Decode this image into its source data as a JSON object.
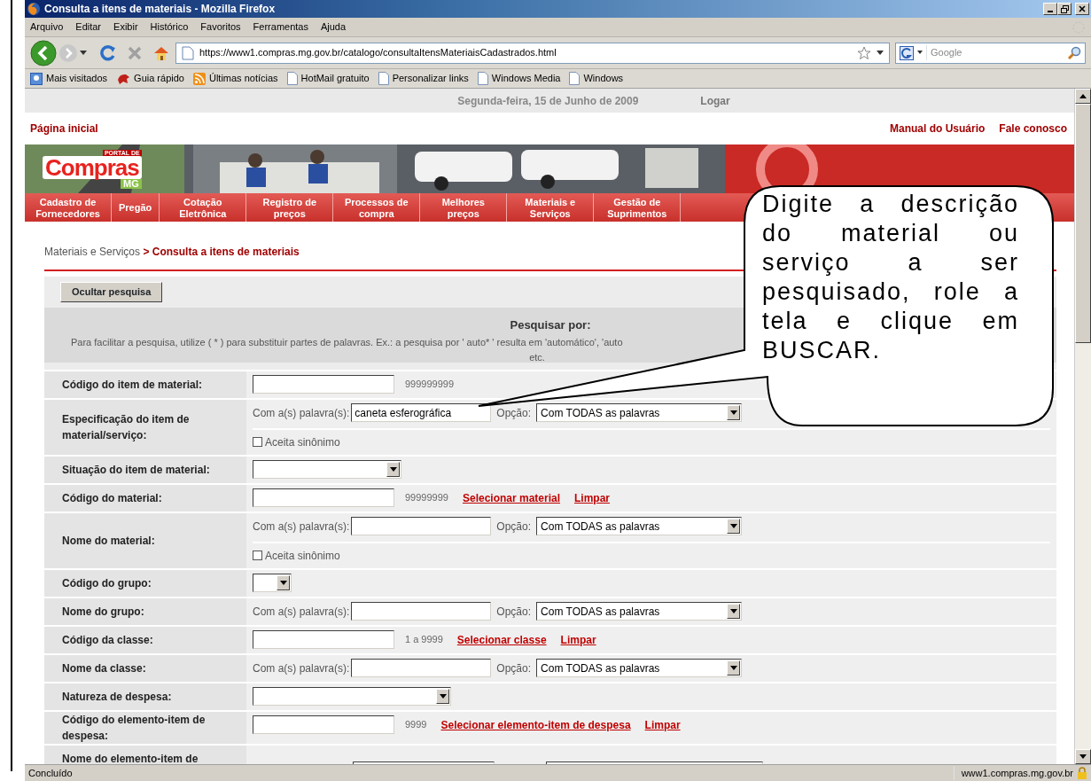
{
  "window": {
    "title": "Consulta a itens de materiais - Mozilla Firefox"
  },
  "menu": [
    "Arquivo",
    "Editar",
    "Exibir",
    "Histórico",
    "Favoritos",
    "Ferramentas",
    "Ajuda"
  ],
  "toolbar": {
    "url": "https://www1.compras.mg.gov.br/catalogo/consultaItensMateriaisCadastrados.html",
    "search_placeholder": "Google"
  },
  "bookmarks": [
    {
      "label": "Mais visitados",
      "kind": "search"
    },
    {
      "label": "Guia rápido",
      "kind": "fox"
    },
    {
      "label": "Últimas notícias",
      "kind": "feed"
    },
    {
      "label": "HotMail gratuito",
      "kind": "page"
    },
    {
      "label": "Personalizar links",
      "kind": "page"
    },
    {
      "label": "Windows Media",
      "kind": "page"
    },
    {
      "label": "Windows",
      "kind": "page"
    }
  ],
  "page": {
    "date": "Segunda-feira, 15 de Junho de 2009",
    "login": "Logar",
    "home_link": "Página inicial",
    "top_links": [
      "Manual do Usuário",
      "Fale conosco"
    ],
    "logo": {
      "top": "PORTAL DE",
      "main": "Compras",
      "sub": "MG"
    },
    "nav": [
      "Cadastro de Fornecedores",
      "Pregão",
      "Cotação Eletrônica",
      "Registro de preços",
      "Processos de compra",
      "Melhores preços",
      "Materiais e Serviços",
      "Gestão de Suprimentos"
    ],
    "breadcrumb": {
      "parent": "Materiais e Serviços",
      "current": "> Consulta a itens de materiais"
    },
    "toggle_button": "Ocultar pesquisa",
    "search_header": {
      "title": "Pesquisar por:",
      "hint": "Para facilitar a pesquisa, utilize ( * ) para substituir partes de palavras. Ex.: a pesquisa por ' auto* ' resulta em 'automático', 'auto",
      "hint_end": "etc."
    },
    "rows": [
      {
        "label": "Código do item de material:",
        "kind": "code",
        "value": "",
        "hint": "999999999"
      },
      {
        "label": "Especificação do item de material/serviço:",
        "kind": "words",
        "prefix": "Com a(s) palavra(s):",
        "value": "caneta esferográfica",
        "option_label": "Opção:",
        "option": "Com TODAS as palavras",
        "synonym": {
          "label": "Aceita sinônimo",
          "checked": false
        }
      },
      {
        "label": "Situação do item de material:",
        "kind": "select",
        "option": ""
      },
      {
        "label": "Código do material:",
        "kind": "code",
        "value": "",
        "hint": "99999999",
        "links": [
          "Selecionar material",
          "Limpar"
        ]
      },
      {
        "label": "Nome do material:",
        "kind": "words",
        "prefix": "Com a(s) palavra(s):",
        "value": "",
        "option_label": "Opção:",
        "option": "Com TODAS as palavras",
        "synonym": {
          "label": "Aceita sinônimo",
          "checked": false
        }
      },
      {
        "label": "Código do grupo:",
        "kind": "select",
        "option": ""
      },
      {
        "label": "Nome do grupo:",
        "kind": "words",
        "prefix": "Com a(s) palavra(s):",
        "value": "",
        "option_label": "Opção:",
        "option": "Com TODAS as palavras"
      },
      {
        "label": "Código da classe:",
        "kind": "code",
        "value": "",
        "hint": "1 a 9999",
        "links": [
          "Selecionar classe",
          "Limpar"
        ]
      },
      {
        "label": "Nome da classe:",
        "kind": "words",
        "prefix": "Com a(s) palavra(s):",
        "value": "",
        "option_label": "Opção:",
        "option": "Com TODAS as palavras"
      },
      {
        "label": "Natureza de despesa:",
        "kind": "select",
        "option": ""
      },
      {
        "label": "Código do elemento-item de despesa:",
        "kind": "code",
        "value": "",
        "hint": "9999",
        "links": [
          "Selecionar elemento-item de despesa",
          "Limpar"
        ]
      },
      {
        "label": "Nome do elemento-item de",
        "kind": "cut"
      }
    ],
    "callout": "Digite a descrição do material ou serviço a ser pesquisado, role a tela e clique em BUSCAR."
  },
  "status_bar": {
    "text": "Concluído",
    "host": "www1.compras.mg.gov.br"
  }
}
